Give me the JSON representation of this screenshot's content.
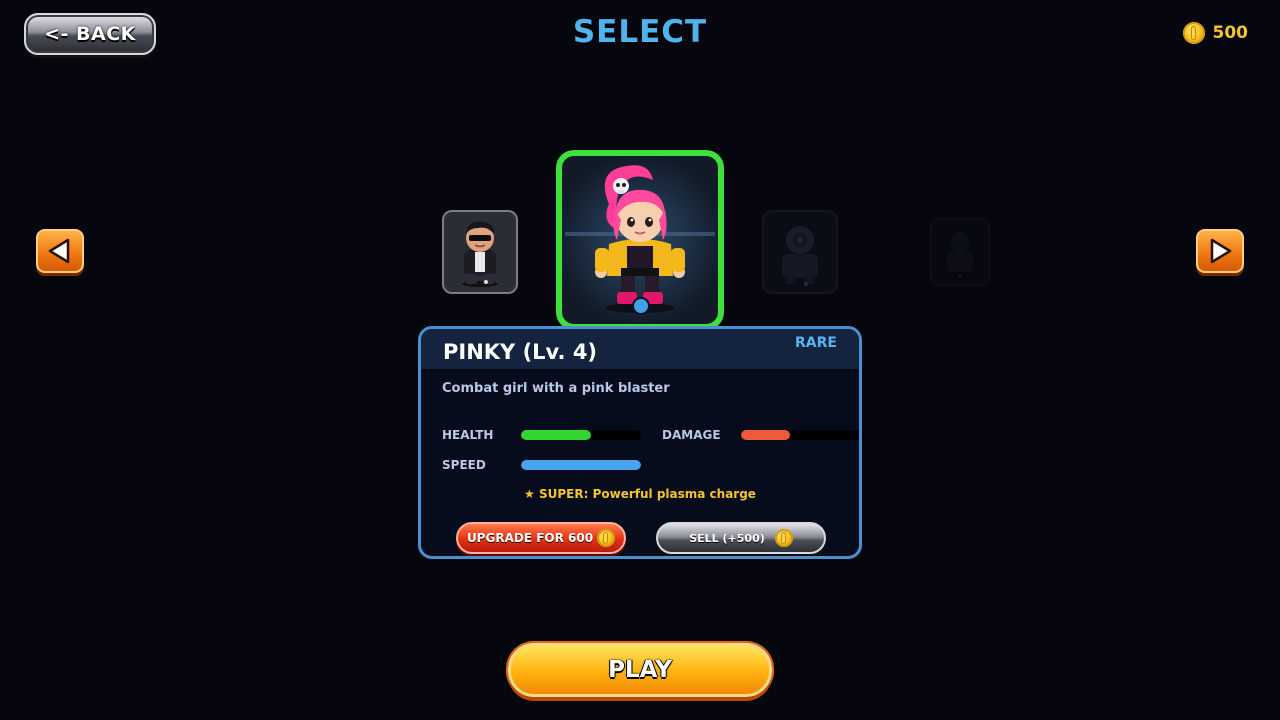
{
  "header": {
    "back_label": "<- BACK",
    "title": "SELECT",
    "coins": "500"
  },
  "carousel": {
    "characters": [
      {
        "name": "black-jacket-sunglasses-character",
        "state": "visible"
      },
      {
        "name": "PINKY",
        "state": "selected"
      },
      {
        "name": "robot-character",
        "state": "dim"
      },
      {
        "name": "locked-character",
        "state": "very-dim"
      }
    ],
    "selected_indicator_color": "#3fa0e6",
    "selected_border_color": "#3ee03a"
  },
  "details": {
    "name": "PINKY (Lv. 4)",
    "rarity": "RARE",
    "description": "Combat girl with a pink blaster",
    "stats": {
      "health": {
        "label": "HEALTH",
        "fill": 0.58,
        "color": "#33d631"
      },
      "damage": {
        "label": "DAMAGE",
        "fill": 0.4,
        "color": "#ef5a3a"
      },
      "speed": {
        "label": "SPEED",
        "fill": 1.0,
        "color": "#4aa3ef"
      }
    },
    "super": "★ SUPER: Powerful plasma charge",
    "upgrade_label": "UPGRADE FOR 600",
    "sell_label": "SELL (+500)"
  },
  "play_label": "PLAY",
  "colors": {
    "accent_blue": "#4fb3ec",
    "coin_gold": "#f4c531",
    "play_orange": "#ffb10f"
  }
}
